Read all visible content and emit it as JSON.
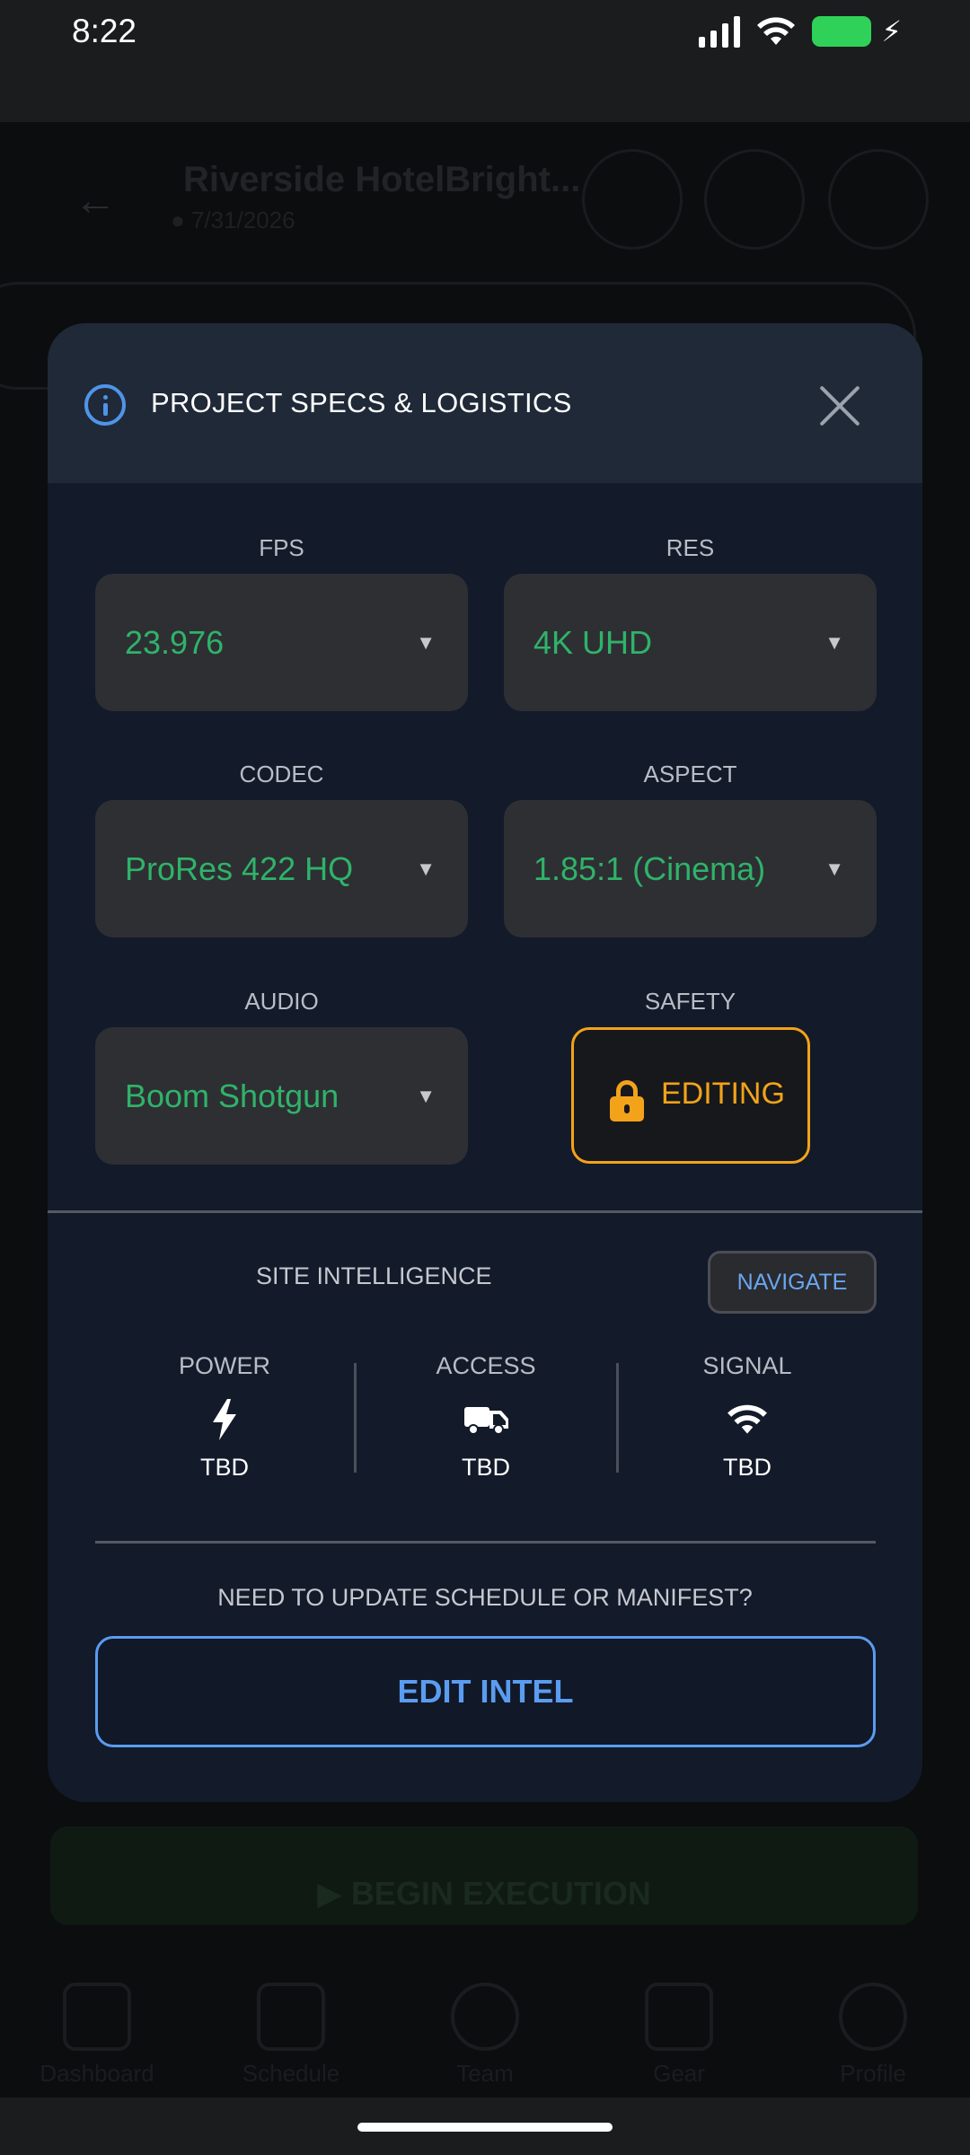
{
  "status_bar": {
    "time": "8:22"
  },
  "background": {
    "title": "Riverside HotelBright...",
    "date": "7/31/2026",
    "begin_label": "▶ BEGIN EXECUTION",
    "tabs": [
      "Dashboard",
      "Schedule",
      "Team",
      "Gear",
      "Profile"
    ]
  },
  "modal": {
    "title": "PROJECT SPECS & LOGISTICS",
    "fields": {
      "fps": {
        "label": "FPS",
        "value": "23.976"
      },
      "res": {
        "label": "RES",
        "value": "4K UHD"
      },
      "codec": {
        "label": "CODEC",
        "value": "ProRes 422 HQ"
      },
      "aspect": {
        "label": "ASPECT",
        "value": "1.85:1 (Cinema)"
      },
      "audio": {
        "label": "AUDIO",
        "value": "Boom Shotgun"
      },
      "safety": {
        "label": "SAFETY",
        "value": "EDITING"
      }
    },
    "site_intel": {
      "title": "SITE INTELLIGENCE",
      "navigate_label": "NAVIGATE",
      "power": {
        "label": "POWER",
        "value": "TBD"
      },
      "access": {
        "label": "ACCESS",
        "value": "TBD"
      },
      "signal": {
        "label": "SIGNAL",
        "value": "TBD"
      }
    },
    "update_prompt": "NEED TO UPDATE SCHEDULE OR MANIFEST?",
    "edit_label": "EDIT INTEL"
  },
  "colors": {
    "accent_green": "#2fb36a",
    "accent_blue": "#5a9cf0",
    "accent_orange": "#f2a31a",
    "modal_bg": "#131a2a"
  }
}
